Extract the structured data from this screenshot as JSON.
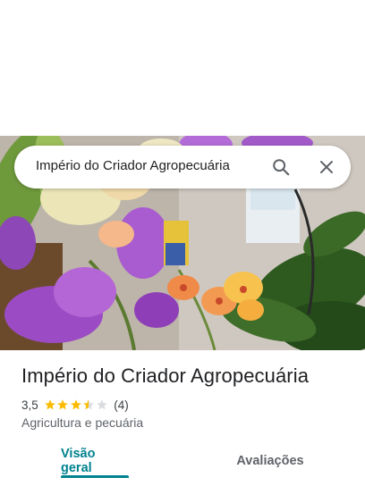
{
  "search": {
    "query": "Império do Criador Agropecuária",
    "search_icon": "search-icon",
    "close_icon": "close-icon"
  },
  "place": {
    "name": "Império do Criador Agropecuária",
    "rating": "3,5",
    "rating_value": 3.5,
    "reviews_count": "(4)",
    "category": "Agricultura e pecuária",
    "star_color": "#fbbc04"
  },
  "photo": {
    "description_icon": "place-photo"
  },
  "tabs": {
    "overview": "Visão geral",
    "reviews": "Avaliações",
    "active_color": "#00838f"
  }
}
